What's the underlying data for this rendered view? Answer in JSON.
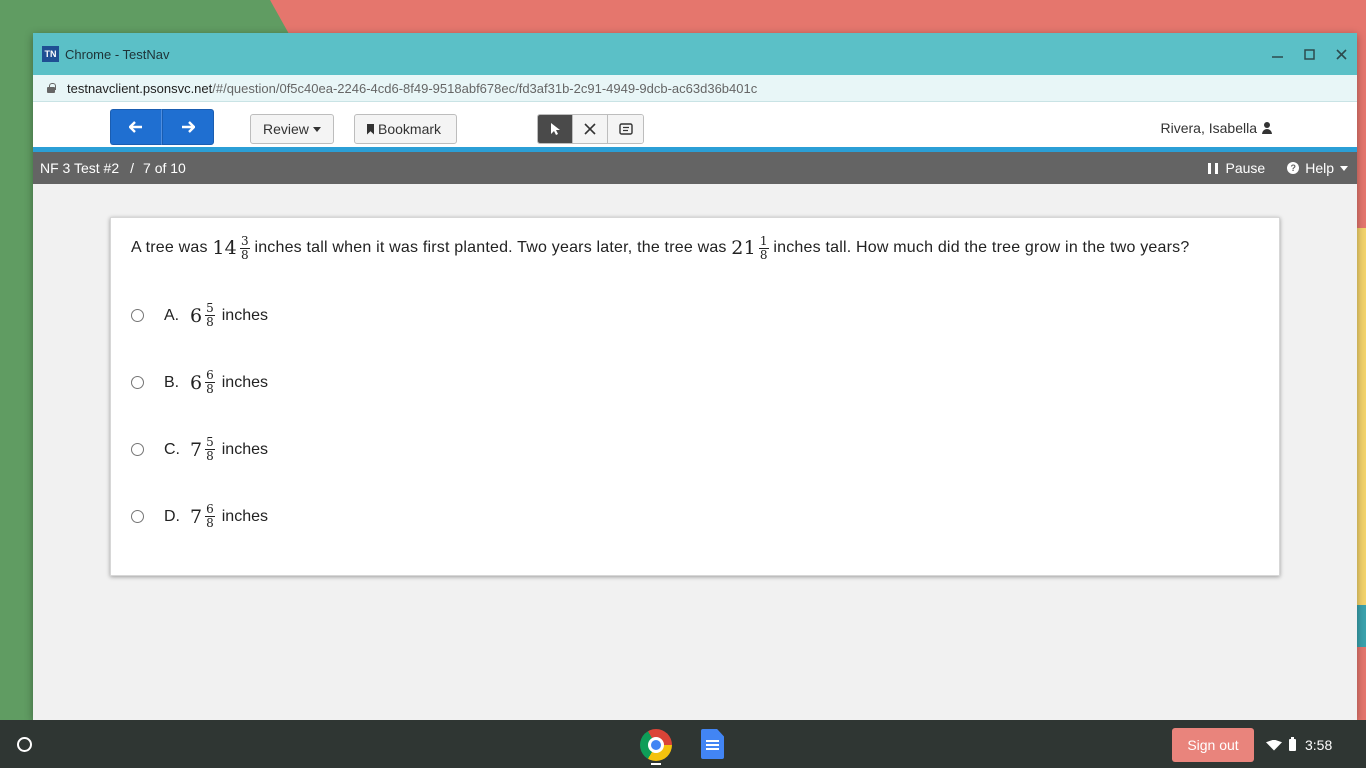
{
  "window": {
    "app_logo": "TN",
    "title": "Chrome - TestNav",
    "url_host": "testnavclient.psonsvc.net",
    "url_path": "/#/question/0f5c40ea-2246-4cd6-8f49-9518abf678ec/fd3af31b-2c91-4949-9dcb-ac63d36b401c"
  },
  "toolbar": {
    "review_label": "Review",
    "bookmark_label": "Bookmark",
    "user_name": "Rivera, Isabella",
    "accent_color": "#1f6fd1"
  },
  "status": {
    "test_name": "NF 3 Test #2",
    "separator": "/",
    "progress": "7 of 10",
    "pause_label": "Pause",
    "help_label": "Help"
  },
  "question": {
    "part1": "A tree was",
    "m1_whole": "14",
    "m1_num": "3",
    "m1_den": "8",
    "part2": "inches tall when it was first planted. Two years later, the tree was",
    "m2_whole": "21",
    "m2_num": "1",
    "m2_den": "8",
    "part3": "inches tall. How much did the tree grow in the two years?"
  },
  "choices": [
    {
      "letter": "A.",
      "whole": "6",
      "num": "5",
      "den": "8",
      "unit": "inches"
    },
    {
      "letter": "B.",
      "whole": "6",
      "num": "6",
      "den": "8",
      "unit": "inches"
    },
    {
      "letter": "C.",
      "whole": "7",
      "num": "5",
      "den": "8",
      "unit": "inches"
    },
    {
      "letter": "D.",
      "whole": "7",
      "num": "6",
      "den": "8",
      "unit": "inches"
    }
  ],
  "taskbar": {
    "sign_out_label": "Sign out",
    "time": "3:58",
    "sign_out_color": "#e9847c"
  }
}
